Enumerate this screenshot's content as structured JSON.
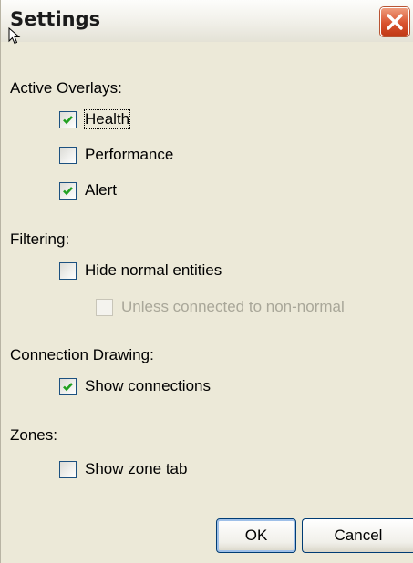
{
  "window": {
    "title": "Settings"
  },
  "sections": {
    "overlays": {
      "label": "Active Overlays:",
      "items": [
        {
          "label": "Health",
          "checked": true
        },
        {
          "label": "Performance",
          "checked": false
        },
        {
          "label": "Alert",
          "checked": true
        }
      ]
    },
    "filtering": {
      "label": "Filtering:",
      "hide_normal": {
        "label": "Hide normal entities",
        "checked": false
      },
      "unless_connected": {
        "label": "Unless connected to non-normal",
        "checked": false,
        "enabled": false
      }
    },
    "connection_drawing": {
      "label": "Connection Drawing:",
      "show_connections": {
        "label": "Show connections",
        "checked": true
      }
    },
    "zones": {
      "label": "Zones:",
      "show_zone_tab": {
        "label": "Show zone tab",
        "checked": false
      }
    }
  },
  "buttons": {
    "ok": "OK",
    "cancel": "Cancel"
  },
  "colors": {
    "check": "#21a121",
    "checkbox_border": "#1c5180",
    "close_button": "#d9532f"
  },
  "icons": {
    "close": "close-icon",
    "check": "checkmark-icon",
    "cursor": "mouse-cursor-icon"
  }
}
